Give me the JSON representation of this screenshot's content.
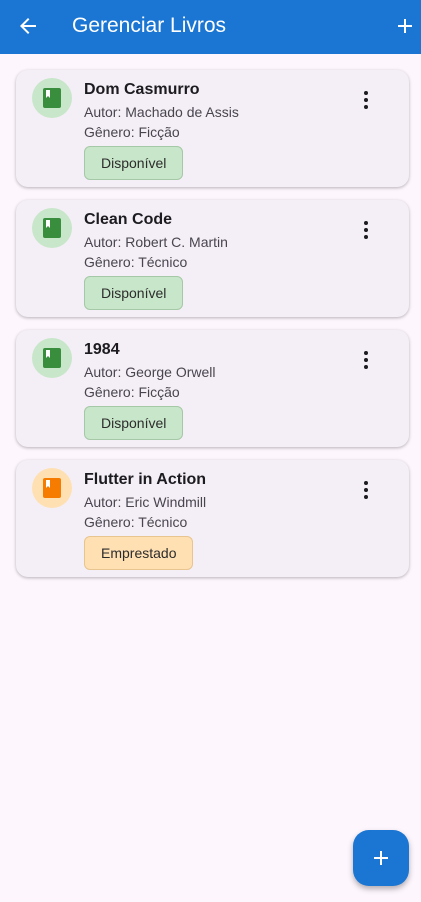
{
  "appbar": {
    "title": "Gerenciar Livros",
    "back_icon": "arrow-back-icon",
    "add_icon": "add-icon"
  },
  "books": [
    {
      "title": "Dom Casmurro",
      "author": "Autor: Machado de Assis",
      "genre": "Gênero: Ficção",
      "status": "Disponível",
      "status_type": "available"
    },
    {
      "title": "Clean Code",
      "author": "Autor: Robert C. Martin",
      "genre": "Gênero: Técnico",
      "status": "Disponível",
      "status_type": "available"
    },
    {
      "title": "1984",
      "author": "Autor: George Orwell",
      "genre": "Gênero: Ficção",
      "status": "Disponível",
      "status_type": "available"
    },
    {
      "title": "Flutter in Action",
      "author": "Autor: Eric Windmill",
      "genre": "Gênero: Técnico",
      "status": "Emprestado",
      "status_type": "borrowed"
    }
  ],
  "colors": {
    "primary": "#1a76d2",
    "background": "#fdf6fd",
    "card": "#f4eff6",
    "available_bg": "#c8e6c9",
    "available_border": "#a5c8a6",
    "available_icon": "#388e3c",
    "available_avatar": "#c8e6c9",
    "borrowed_bg": "#ffe0b2",
    "borrowed_border": "#e8c48e",
    "borrowed_icon": "#f57c00",
    "borrowed_avatar": "#ffe0b2"
  },
  "fab": {
    "icon": "add-icon"
  }
}
